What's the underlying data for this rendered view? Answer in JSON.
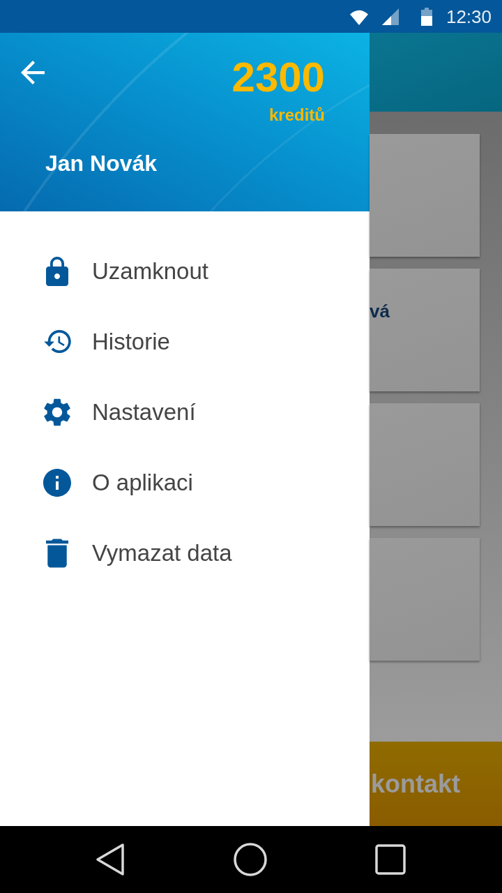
{
  "status_bar": {
    "time": "12:30"
  },
  "drawer": {
    "header": {
      "credits": "2300",
      "credits_label": "kreditů",
      "user_name": "Jan Novák"
    },
    "items": [
      {
        "label": "Uzamknout"
      },
      {
        "label": "Historie"
      },
      {
        "label": "Nastavení"
      },
      {
        "label": "O aplikaci"
      },
      {
        "label": "Vymazat data"
      }
    ]
  },
  "background_screen": {
    "card": {
      "text": "vá"
    },
    "button": {
      "label": "kontakt"
    }
  }
}
